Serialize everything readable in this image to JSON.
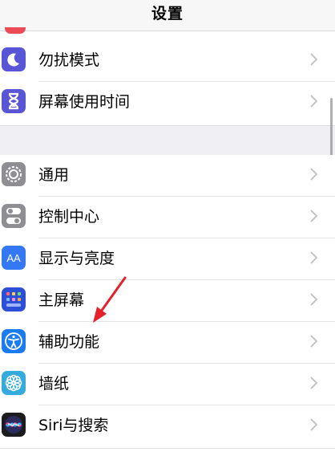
{
  "nav": {
    "title": "设置"
  },
  "group1": [
    {
      "label": "勿扰模式",
      "icon": "moon-icon",
      "color": "#5856d6"
    },
    {
      "label": "屏幕使用时间",
      "icon": "hourglass-icon",
      "color": "#5856d6"
    }
  ],
  "group2": [
    {
      "label": "通用",
      "icon": "gear-icon",
      "color": "#8e8e93"
    },
    {
      "label": "控制中心",
      "icon": "toggles-icon",
      "color": "#8e8e93"
    },
    {
      "label": "显示与亮度",
      "icon": "text-size-icon",
      "color": "#3478f6",
      "glyph": "AA"
    },
    {
      "label": "主屏幕",
      "icon": "home-grid-icon",
      "color": "#2c4fd8"
    },
    {
      "label": "辅助功能",
      "icon": "accessibility-icon",
      "color": "#1a7cf5"
    },
    {
      "label": "墙纸",
      "icon": "flower-icon",
      "color": "#35aadc"
    },
    {
      "label": "Siri与搜索",
      "icon": "siri-icon",
      "color": "#1c1c1e"
    }
  ],
  "colors": {
    "annotation_arrow": "#e5202a",
    "chevron": "#c4c4c7"
  }
}
